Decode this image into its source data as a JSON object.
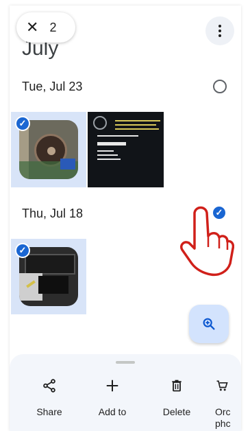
{
  "header": {
    "month_title": "July",
    "selected_count": "2",
    "close_icon": "close-icon",
    "more_icon": "more-vert-icon"
  },
  "sections": [
    {
      "date": "Tue, Jul 23",
      "selected": false,
      "photos": [
        {
          "name": "photo-motherboard",
          "selected": true
        },
        {
          "name": "photo-bios-screen",
          "selected": false
        }
      ]
    },
    {
      "date": "Thu, Jul 18",
      "selected": true,
      "photos": [
        {
          "name": "photo-monitor",
          "selected": true
        }
      ]
    }
  ],
  "zoom_button": {
    "icon": "zoom-in-icon"
  },
  "bottom_actions": [
    {
      "label": "Share",
      "icon": "share-icon"
    },
    {
      "label": "Add to",
      "icon": "plus-icon"
    },
    {
      "label": "Delete",
      "icon": "trash-icon"
    },
    {
      "label": "Orc\nphc",
      "icon": "order-photos-icon"
    }
  ],
  "colors": {
    "accent": "#1a66d2",
    "selection_bg": "#d8e4f8",
    "sheet_bg": "#f3f6fb",
    "fab_bg": "#d3e3fd",
    "hand_outline": "#d0201a"
  }
}
